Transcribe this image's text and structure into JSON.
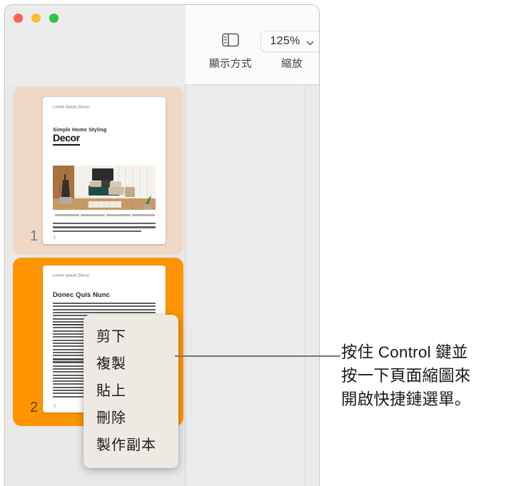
{
  "window": {
    "traffic_lights": [
      {
        "name": "close",
        "color": "#ff5f57"
      },
      {
        "name": "minimize",
        "color": "#febc2e"
      },
      {
        "name": "maximize",
        "color": "#28c840"
      }
    ]
  },
  "toolbar": {
    "view_icon": "sidebar-view-icon",
    "view_label": "顯示方式",
    "zoom_value": "125%",
    "zoom_label": "縮放",
    "zoom_chevron": "chevron-down-icon"
  },
  "sidebar": {
    "thumbnails": [
      {
        "number": "1",
        "selected": false,
        "highlight_color": "#f0d8c6",
        "page": {
          "header": "Lorem Ipsum Decor",
          "eyebrow": "Simple Home Styling",
          "title": "Decor",
          "caption": "Lorem ipsum dolor sit amet, ligula suspendisse nulla pretium. Vivamus tempor bibendum.",
          "folio": "1"
        }
      },
      {
        "number": "2",
        "selected": true,
        "highlight_color": "#ff9500",
        "page": {
          "header": "Lorem Ipsum Decor",
          "title": "Donec Quis Nunc",
          "folio": "2"
        }
      }
    ]
  },
  "context_menu": {
    "items": [
      {
        "label": "剪下"
      },
      {
        "label": "複製"
      },
      {
        "label": "貼上"
      },
      {
        "label": "刪除"
      },
      {
        "label": "製作副本"
      }
    ]
  },
  "callout": {
    "lines": [
      "按住 Control 鍵並",
      "按一下頁面縮圖來",
      "開啟快捷鏈選單。"
    ],
    "leader_color": "#767676"
  }
}
